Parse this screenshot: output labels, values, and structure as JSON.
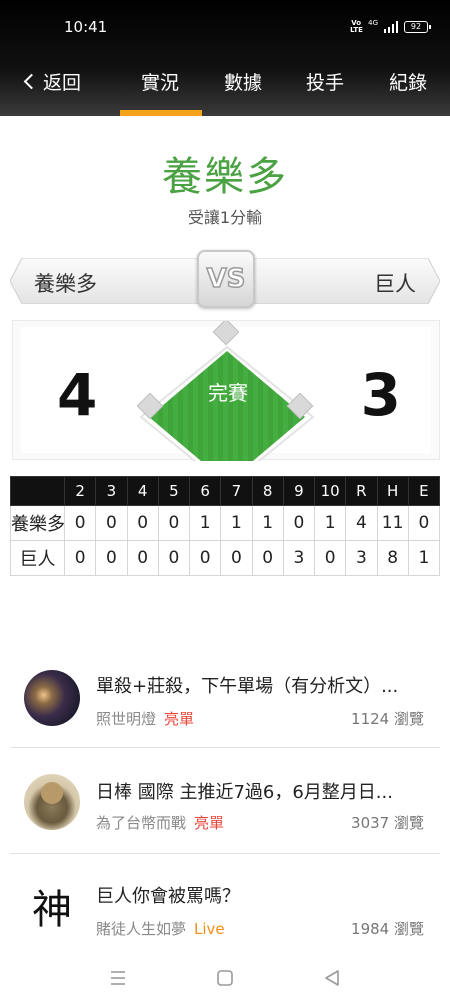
{
  "status_bar": {
    "time": "10:41",
    "volte": "Vo LTE",
    "network": "4G",
    "battery": "92"
  },
  "nav": {
    "back_label": "返回",
    "tabs": [
      {
        "label": "實況",
        "active": true
      },
      {
        "label": "數據",
        "active": false
      },
      {
        "label": "投手",
        "active": false
      },
      {
        "label": "紀錄",
        "active": false
      }
    ],
    "accent_color": "#f5a31a"
  },
  "result": {
    "winner": "養樂多",
    "handicap_text": "受讓1分輸"
  },
  "matchup": {
    "away_team": "養樂多",
    "home_team": "巨人",
    "vs_label": "VS"
  },
  "score": {
    "away": "4",
    "home": "3",
    "status": "完賽"
  },
  "linescore": {
    "headers": [
      "2",
      "3",
      "4",
      "5",
      "6",
      "7",
      "8",
      "9",
      "10",
      "R",
      "H",
      "E"
    ],
    "rows": [
      {
        "team": "養樂多",
        "values": [
          "0",
          "0",
          "0",
          "0",
          "1",
          "1",
          "1",
          "0",
          "1",
          "4",
          "11",
          "0"
        ]
      },
      {
        "team": "巨人",
        "values": [
          "0",
          "0",
          "0",
          "0",
          "0",
          "0",
          "0",
          "3",
          "0",
          "3",
          "8",
          "1"
        ]
      }
    ]
  },
  "articles": [
    {
      "title": "單殺+莊殺，下午單場（有分析文）...",
      "author": "照世明燈",
      "tag": "亮單",
      "tag_color": "#e8493b",
      "views": "1124 瀏覽",
      "avatar_icon": "user-photo-icon"
    },
    {
      "title": "日棒 國際 主推近7過6，6月整月日...",
      "author": "為了台幣而戰",
      "tag": "亮單",
      "tag_color": "#e8493b",
      "views": "3037 瀏覽",
      "avatar_icon": "user-photo-icon"
    },
    {
      "title": "巨人你會被罵嗎？",
      "author": "賭徒人生如夢",
      "tag": "Live",
      "tag_color": "#f0901a",
      "views": "1984 瀏覽",
      "avatar_glyph": "神"
    }
  ],
  "system_nav": {
    "icons": [
      "menu-icon",
      "home-icon",
      "back-icon"
    ]
  }
}
